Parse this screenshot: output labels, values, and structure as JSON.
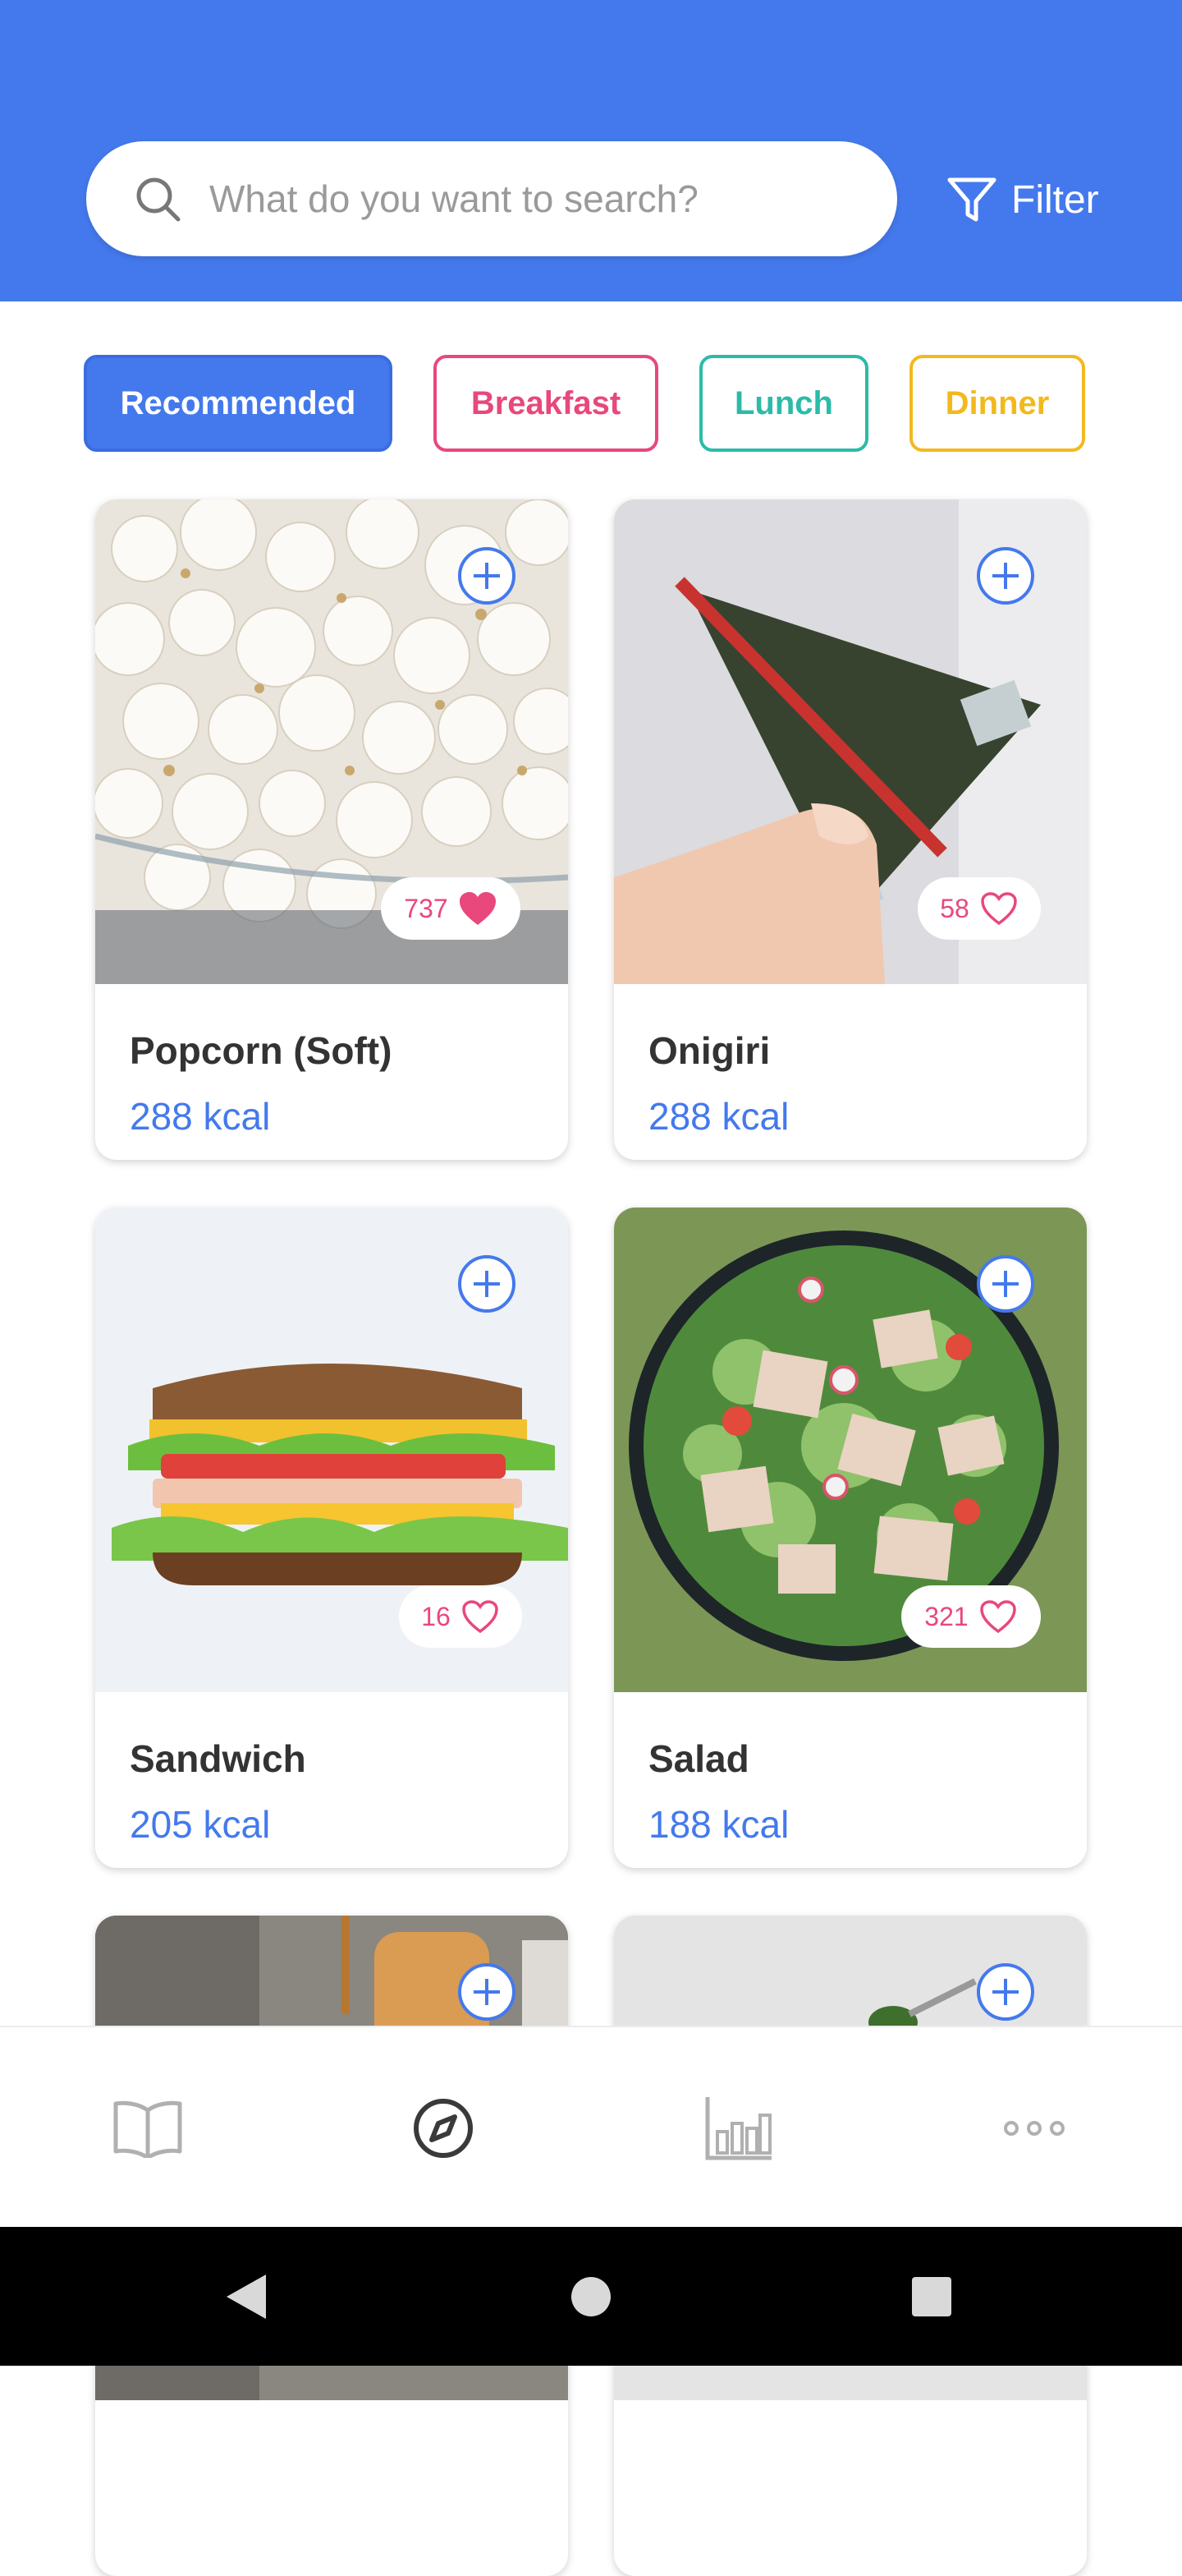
{
  "header": {
    "search_placeholder": "What do you want to search?",
    "filter_label": "Filter",
    "search_icon": "search-icon",
    "filter_icon": "filter-icon",
    "background": "#4479ED"
  },
  "categories": [
    {
      "label": "Recommended",
      "color": "#4479ED",
      "selected": true
    },
    {
      "label": "Breakfast",
      "color": "#E8487B",
      "selected": false
    },
    {
      "label": "Lunch",
      "color": "#2BBBA8",
      "selected": false
    },
    {
      "label": "Dinner",
      "color": "#F2B91F",
      "selected": false
    }
  ],
  "foods": [
    {
      "name": "Popcorn (Soft)",
      "kcal": "288 kcal",
      "likes": "737",
      "liked": true
    },
    {
      "name": "Onigiri",
      "kcal": "288 kcal",
      "likes": "58",
      "liked": false
    },
    {
      "name": "Sandwich",
      "kcal": "205 kcal",
      "likes": "16",
      "liked": false
    },
    {
      "name": "Salad",
      "kcal": "188 kcal",
      "likes": "321",
      "liked": false
    }
  ],
  "bottom_nav": [
    {
      "icon": "book-icon",
      "active": false
    },
    {
      "icon": "compass-icon",
      "active": true
    },
    {
      "icon": "bar-chart-icon",
      "active": false
    },
    {
      "icon": "more-icon",
      "active": false
    }
  ],
  "system_nav": [
    "back-icon",
    "home-icon",
    "recents-icon"
  ],
  "colors": {
    "accent": "#4479ED",
    "like": "#E8487B"
  }
}
